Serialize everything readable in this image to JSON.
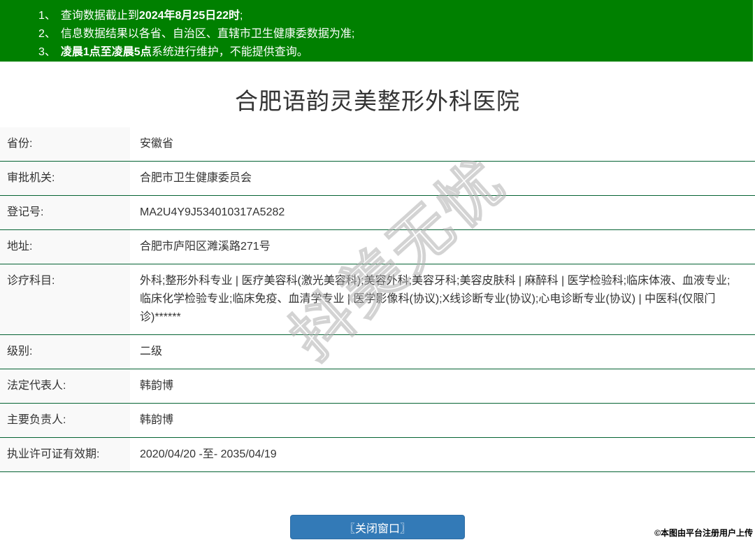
{
  "notices": [
    {
      "number": "1、",
      "prefix": "查询数据截止到",
      "bold": "2024年8月25日22时",
      "suffix": ";"
    },
    {
      "number": "2、",
      "prefix": "信息数据结果以各省、自治区、直辖市卫生健康委数据为准;",
      "bold": "",
      "suffix": ""
    },
    {
      "number": "3、",
      "prefix": "",
      "bold": "凌晨1点至凌晨5点",
      "suffix": "系统进行维护，不能提供查询。"
    }
  ],
  "title": "合肥语韵灵美整形外科医院",
  "table": {
    "rows": [
      {
        "label": "省份:",
        "value": "安徽省"
      },
      {
        "label": "审批机关:",
        "value": "合肥市卫生健康委员会"
      },
      {
        "label": "登记号:",
        "value": "MA2U4Y9J534010317A5282"
      },
      {
        "label": "地址:",
        "value": "合肥市庐阳区濉溪路271号"
      },
      {
        "label": "诊疗科目:",
        "value": "外科;整形外科专业 | 医疗美容科(激光美容科);美容外科;美容牙科;美容皮肤科 | 麻醉科 | 医学检验科;临床体液、血液专业;临床化学检验专业;临床免疫、血清学专业 | 医学影像科(协议);X线诊断专业(协议);心电诊断专业(协议) | 中医科(仅限门诊)******"
      },
      {
        "label": "级别:",
        "value": "二级"
      },
      {
        "label": "法定代表人:",
        "value": "韩韵博"
      },
      {
        "label": "主要负责人:",
        "value": "韩韵博"
      },
      {
        "label": "执业许可证有效期:",
        "value": "2020/04/20 -至- 2035/04/19"
      }
    ]
  },
  "close_button_label": "〖关闭窗口〗",
  "watermark": "抖美无忧",
  "copyright": "©本图由平台注册用户上传",
  "colors": {
    "header_bg": "#008000",
    "row_border_green": "#056333",
    "label_bg": "#f9f9f9",
    "button_bg": "#337ab7",
    "button_border": "#2e6da4"
  }
}
